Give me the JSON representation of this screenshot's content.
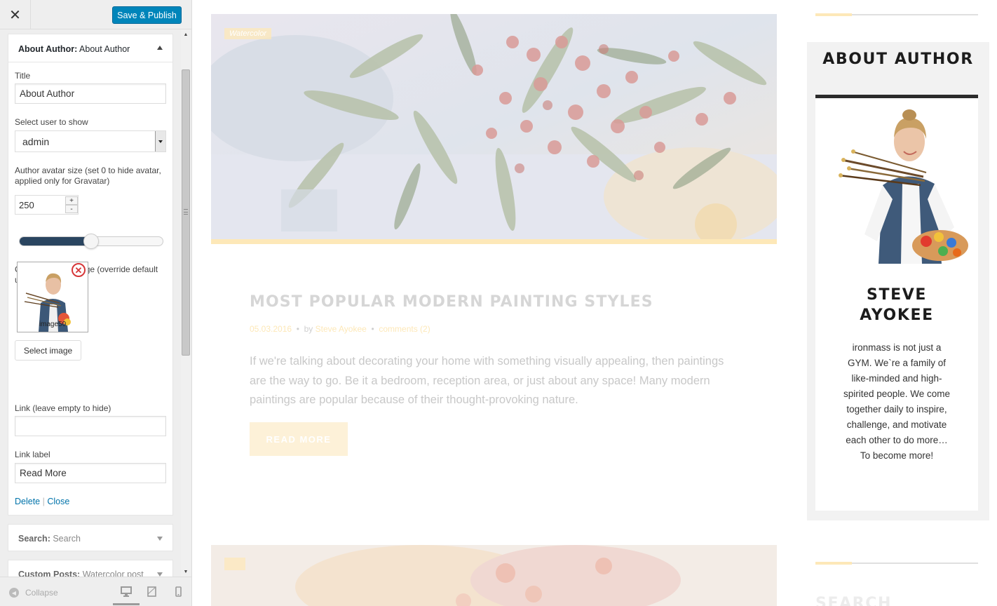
{
  "customizer": {
    "close_icon": "close-icon",
    "save_label": "Save & Publish",
    "widget": {
      "type_label": "About Author:",
      "name": "About Author",
      "fields": {
        "title_label": "Title",
        "title_value": "About Author",
        "user_label": "Select user to show",
        "user_value": "admin",
        "avatar_size_label": "Author avatar size (set 0 to hide avatar, applied only for Gravatar)",
        "avatar_size_value": "250",
        "avatar_slider_fraction": 0.5,
        "custom_avatar_label": "Custom avatar image (override default user avatar)",
        "custom_avatar_filename": "image50",
        "select_image_label": "Select image",
        "link_label": "Link (leave empty to hide)",
        "link_value": "",
        "link_label_label": "Link label",
        "link_label_value": "Read More"
      },
      "actions": {
        "delete": "Delete",
        "separator": "|",
        "close": "Close"
      }
    },
    "collapsed_widgets": [
      {
        "type": "Search:",
        "name": "Search"
      },
      {
        "type": "Custom Posts:",
        "name": "Watercolor post"
      }
    ],
    "footer": {
      "collapse_label": "Collapse",
      "devices": [
        "desktop-icon",
        "tablet-icon",
        "mobile-icon"
      ]
    }
  },
  "preview": {
    "post": {
      "category": "Watercolor",
      "title": "MOST POPULAR MODERN PAINTING STYLES",
      "date": "05.03.2016",
      "by": "by",
      "author": "Steve Ayokee",
      "comments": "comments (2)",
      "excerpt": "If we're talking about decorating your home with something visually appealing, then paintings are the way to go. Be it a bedroom, reception area, or just about any space! Many modern paintings are popular because of their thought-provoking nature.",
      "read_more": "READ MORE"
    },
    "sidebar": {
      "widget_title": "ABOUT AUTHOR",
      "author_name": "STEVE AYOKEE",
      "author_bio": "ironmass is not just a GYM. We`re a family of like-minded and high-spirited people. We come together daily to inspire, challenge, and motivate each other to do more… To become more!",
      "next_widget_title": "SEARCH"
    },
    "colors": {
      "accent": "#fde8b8",
      "dark": "#1c1c1c",
      "wp_blue": "#0085ba"
    }
  }
}
